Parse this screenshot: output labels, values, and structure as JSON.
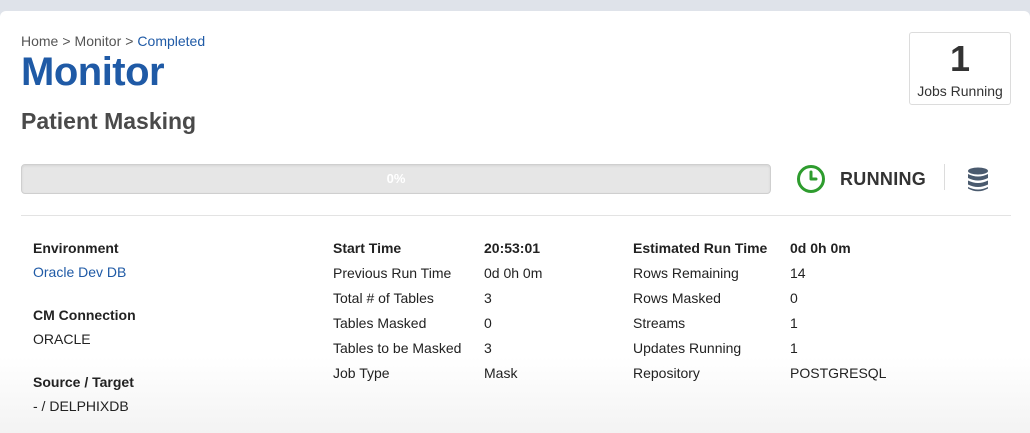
{
  "breadcrumb": {
    "home": "Home",
    "separator": ">",
    "monitor": "Monitor",
    "current": "Completed"
  },
  "page_title": "Monitor",
  "job_name": "Patient Masking",
  "jobs_running": {
    "count": "1",
    "label": "Jobs Running"
  },
  "progress": {
    "percent": 0,
    "label": "0%"
  },
  "status": {
    "text": "RUNNING",
    "icon": "clock-icon",
    "color": "#2e9c2e"
  },
  "repository_icon": "database-icon",
  "details": {
    "environment": {
      "label": "Environment",
      "value": "Oracle Dev DB"
    },
    "connection": {
      "label": "CM Connection",
      "value": "ORACLE"
    },
    "source_target": {
      "label": "Source / Target",
      "value": "- / DELPHIXDB"
    }
  },
  "stats_left": [
    {
      "label": "Start Time",
      "value": "20:53:01"
    },
    {
      "label": "Previous Run Time",
      "value": "0d 0h 0m"
    },
    {
      "label": "Total # of Tables",
      "value": "3"
    },
    {
      "label": "Tables Masked",
      "value": "0"
    },
    {
      "label": "Tables to be Masked",
      "value": "3"
    },
    {
      "label": "Job Type",
      "value": "Mask"
    }
  ],
  "stats_right": [
    {
      "label": "Estimated Run Time",
      "value": "0d 0h 0m"
    },
    {
      "label": "Rows Remaining",
      "value": "14"
    },
    {
      "label": "Rows Masked",
      "value": "0"
    },
    {
      "label": "Streams",
      "value": "1"
    },
    {
      "label": "Updates Running",
      "value": "1"
    },
    {
      "label": "Repository",
      "value": "POSTGRESQL"
    }
  ],
  "colors": {
    "accent": "#1f5aa6",
    "running": "#2e9c2e",
    "progress_fill": "#7ab55c"
  }
}
